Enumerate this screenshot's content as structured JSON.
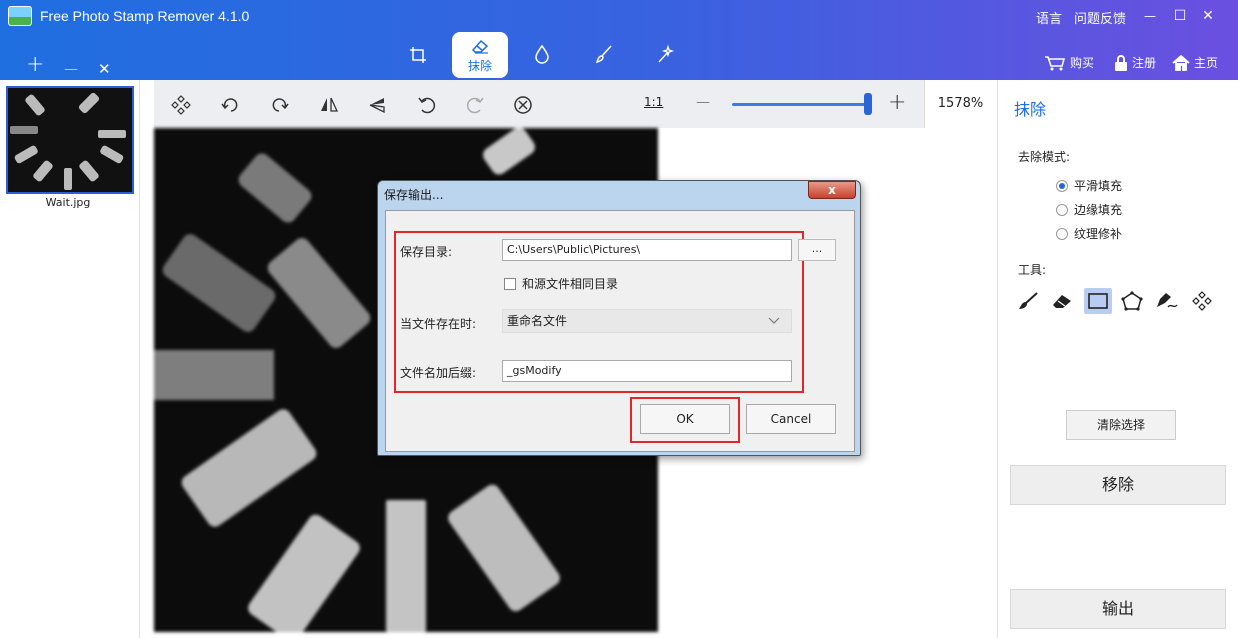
{
  "header": {
    "app_title": "Free Photo Stamp Remover 4.1.0",
    "language_label": "语言",
    "feedback_label": "问题反馈",
    "minimize_glyph": "—",
    "maximize_glyph": "☐",
    "close_glyph": "✕",
    "file_add_glyph": "+",
    "file_remove_glyph": "—",
    "file_clear_glyph": "✕",
    "tabs": [
      {
        "icon": "crop-icon",
        "label": ""
      },
      {
        "icon": "eraser-icon",
        "label": "抹除",
        "active": true
      },
      {
        "icon": "drop-icon",
        "label": ""
      },
      {
        "icon": "brush-icon",
        "label": ""
      },
      {
        "icon": "magic-wand-icon",
        "label": ""
      }
    ],
    "buy_label": "购买",
    "register_label": "注册",
    "home_label": "主页"
  },
  "thumbnails": [
    {
      "name": "Wait.jpg"
    }
  ],
  "toolbar": {
    "ratio_label": "1:1",
    "zoom_minus": "—",
    "zoom_plus": "+",
    "zoom_value": "1578%",
    "zoom_level_fraction": 0.97
  },
  "right_panel": {
    "title": "抹除",
    "mode_label": "去除模式:",
    "modes": [
      {
        "label": "平滑填充",
        "checked": true
      },
      {
        "label": "边缘填充",
        "checked": false
      },
      {
        "label": "纹理修补",
        "checked": false
      }
    ],
    "tools_label": "工具:",
    "tools": [
      "brush-icon",
      "eraser-icon",
      "rectangle-icon",
      "polygon-icon",
      "pen-icon",
      "move-icon"
    ],
    "selected_tool": "rectangle-icon",
    "clear_selection_label": "清除选择",
    "remove_label": "移除",
    "output_label": "输出"
  },
  "dialog": {
    "title": "保存输出...",
    "close_glyph": "x",
    "save_dir_label": "保存目录:",
    "save_dir_value": "C:\\Users\\Public\\Pictures\\",
    "browse_label": "...",
    "same_dir_label": "和源文件相同目录",
    "same_dir_checked": false,
    "exists_label": "当文件存在时:",
    "exists_value": "重命名文件",
    "suffix_label": "文件名加后缀:",
    "suffix_value": "_gsModify",
    "ok_label": "OK",
    "cancel_label": "Cancel"
  },
  "colors": {
    "header_start": "#1f6fe0",
    "header_end": "#6b4fe0",
    "accent": "#2a64d6",
    "highlight_frame": "#e02828"
  }
}
